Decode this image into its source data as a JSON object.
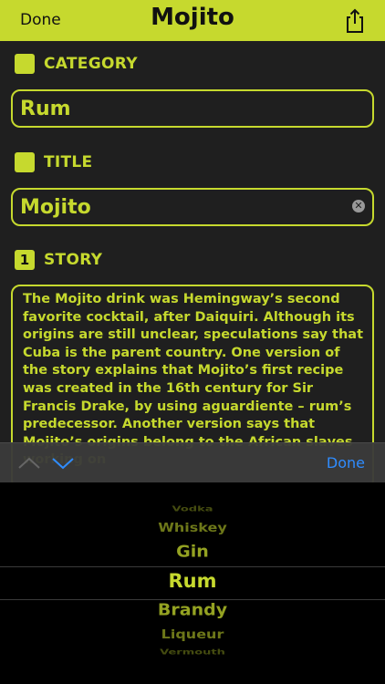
{
  "navbar": {
    "done_label": "Done",
    "title": "Mojito",
    "share_icon": "share-icon"
  },
  "category": {
    "label": "CATEGORY",
    "value": "Rum"
  },
  "title_section": {
    "label": "TITLE",
    "value": "Mojito"
  },
  "story": {
    "badge": "1",
    "label": "STORY",
    "text": "The Mojito drink was Hemingway’s second favorite cocktail, after Daiquiri. Although its origins are still unclear, speculations say that Cuba is the parent country. One version of the story explains that Mojito’s first recipe was created in the 16th century for Sir Francis Drake, by using aguardiente – rum’s predecessor. Another version says that Mojito’s origins belong to the African slaves working on"
  },
  "keyboard_toolbar": {
    "done_label": "Done"
  },
  "picker": {
    "options": [
      "Vodka",
      "Whiskey",
      "Gin",
      "Rum",
      "Brandy",
      "Liqueur",
      "Vermouth"
    ],
    "selected": "Rum"
  },
  "colors": {
    "accent": "#c6d92e",
    "background": "#1f1f1f",
    "toolbar_blue": "#2f8cff"
  }
}
